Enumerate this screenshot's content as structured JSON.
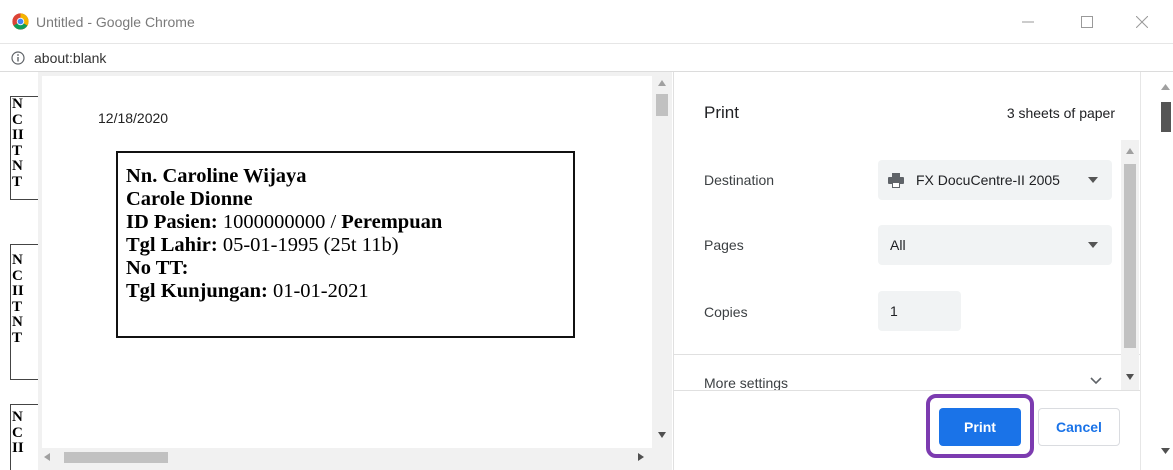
{
  "window": {
    "title": "Untitled - Google Chrome",
    "url": "about:blank"
  },
  "background_page": {
    "blocks": [
      [
        "N",
        "C",
        "II",
        "T",
        "N",
        "T"
      ],
      [
        "N",
        "C",
        "II",
        "T",
        "N",
        "T"
      ],
      [
        "N",
        "C",
        "II"
      ]
    ],
    "cut_line": "Pasien: 1000000000 / Perempuan"
  },
  "preview": {
    "date": "12/18/2020",
    "label": {
      "name": "Nn. Caroline Wijaya",
      "alias": "Carole Dionne",
      "id_label": "ID Pasien:",
      "id_value": " 1000000000 / ",
      "gender": "Perempuan",
      "dob_label": "Tgl Lahir:",
      "dob_value": " 05-01-1995 (25t 11b)",
      "tt_label": "No TT:",
      "visit_label": "Tgl Kunjungan:",
      "visit_value": " 01-01-2021"
    }
  },
  "print_panel": {
    "title": "Print",
    "sheets": "3 sheets of paper",
    "destination_label": "Destination",
    "destination_value": "FX DocuCentre-II 2005",
    "pages_label": "Pages",
    "pages_value": "All",
    "copies_label": "Copies",
    "copies_value": "1",
    "more_settings": "More settings",
    "print_button": "Print",
    "cancel_button": "Cancel"
  },
  "colors": {
    "primary": "#1a73e8",
    "highlight": "#7c3bb0"
  }
}
